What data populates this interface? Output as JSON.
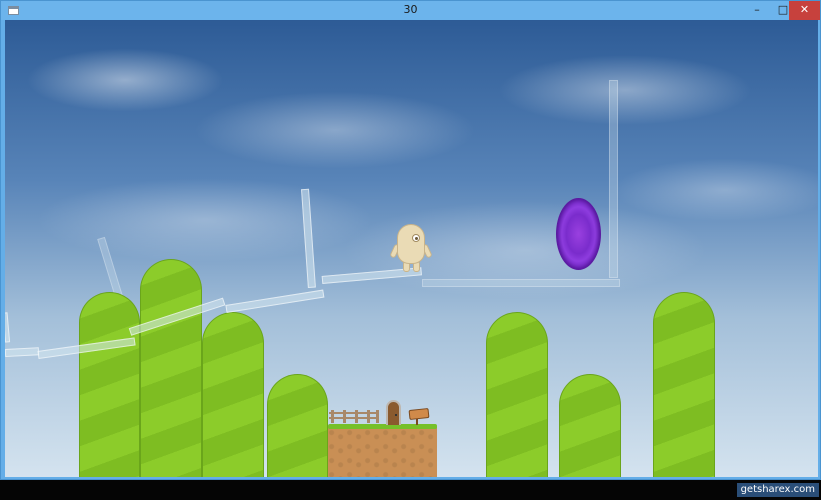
{
  "window": {
    "title": "30",
    "controls": {
      "minimize": "–",
      "maximize": "□",
      "close": "✕"
    }
  },
  "scene": {
    "background": "cloudy-sky",
    "portal_color": "#8f3de0",
    "hill_color": "#8ccc2a",
    "character": "one-eyed-creature"
  },
  "watermark": "getsharex.com"
}
